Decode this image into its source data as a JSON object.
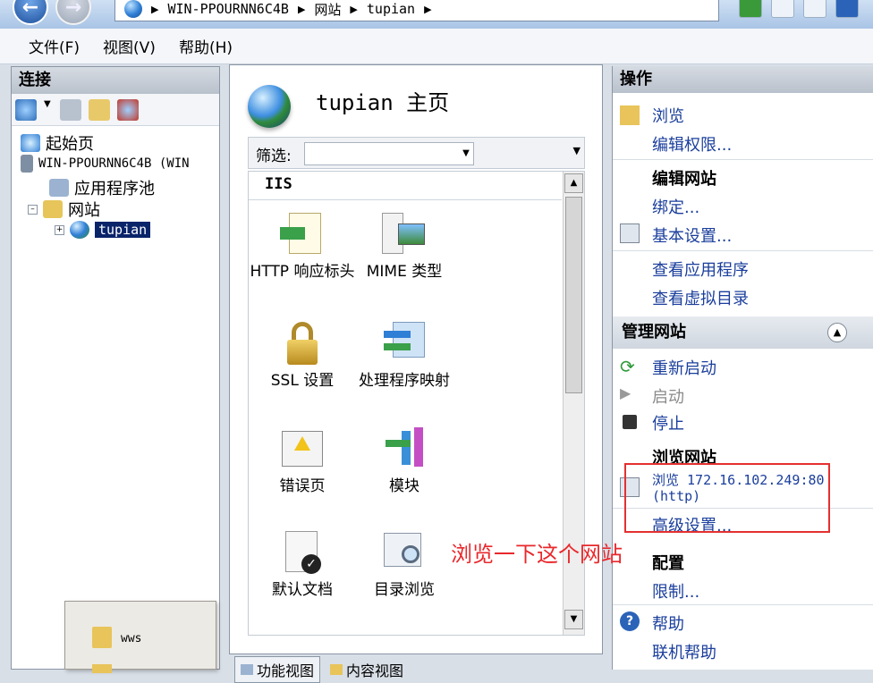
{
  "address_bar": {
    "crumbs": [
      "WIN-PPOURNN6C4B",
      "网站",
      "tupian"
    ]
  },
  "menu": [
    "文件(F)",
    "视图(V)",
    "帮助(H)"
  ],
  "connections": {
    "title": "连接",
    "tree": {
      "start_page": "起始页",
      "server": "WIN-PPOURNN6C4B (WIN",
      "app_pools": "应用程序池",
      "sites": "网站",
      "site": "tupian"
    }
  },
  "center": {
    "title": "tupian 主页",
    "filter_label": "筛选:",
    "group": "IIS",
    "features": [
      {
        "label": "HTTP 响应标头",
        "icon": "http-response-headers-icon"
      },
      {
        "label": "MIME 类型",
        "icon": "mime-types-icon"
      },
      {
        "label": "SSL 设置",
        "icon": "lock-icon"
      },
      {
        "label": "处理程序映射",
        "icon": "handler-mappings-icon"
      },
      {
        "label": "错误页",
        "icon": "error-page-icon"
      },
      {
        "label": "模块",
        "icon": "modules-icon"
      },
      {
        "label": "默认文档",
        "icon": "default-document-icon"
      },
      {
        "label": "目录浏览",
        "icon": "directory-browsing-icon"
      }
    ],
    "tabs": [
      "功能视图",
      "内容视图"
    ]
  },
  "popup": {
    "folder": "wws"
  },
  "actions": {
    "title": "操作",
    "explore": "浏览",
    "edit_permissions": "编辑权限...",
    "edit_site_head": "编辑网站",
    "bindings": "绑定...",
    "basic_settings": "基本设置...",
    "view_apps": "查看应用程序",
    "view_vdirs": "查看虚拟目录",
    "manage_site": "管理网站",
    "restart": "重新启动",
    "start": "启动",
    "stop": "停止",
    "browse_site_head": "浏览网站",
    "browse_link_1": "浏览 172.16.102.249:80",
    "browse_link_2": "(http)",
    "advanced_settings": "高级设置...",
    "config_head": "配置",
    "limits": "限制...",
    "help": "帮助",
    "online_help": "联机帮助"
  },
  "annotation": "浏览一下这个网站",
  "colors": {
    "annotation": "#e9282c",
    "link": "#1a3e9c",
    "selection": "#0a246a"
  }
}
